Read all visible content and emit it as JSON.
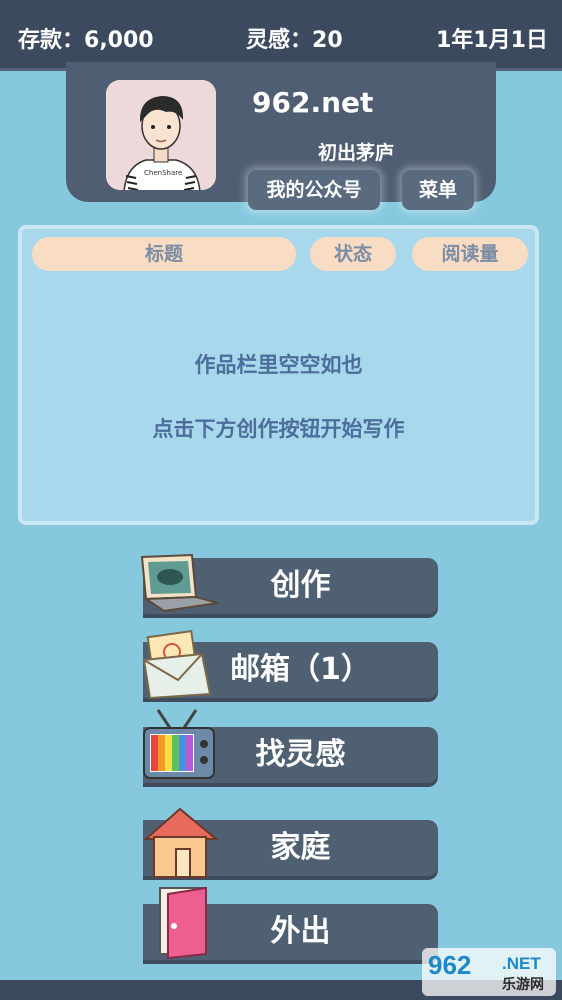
{
  "status": {
    "money_label": "存款：",
    "money_value": "6,000",
    "inspiration_label": "灵感：",
    "inspiration_value": "20",
    "date": "1年1月1日"
  },
  "profile": {
    "avatar_shirt_text": "ChenShare",
    "name": "962.net",
    "title": "初出茅庐",
    "wechat_button": "我的公众号",
    "menu_button": "菜单"
  },
  "works": {
    "columns": [
      "标题",
      "状态",
      "阅读量"
    ],
    "empty_line1": "作品栏里空空如也",
    "empty_line2": "点击下方创作按钮开始写作"
  },
  "actions": [
    {
      "label": "创作",
      "icon": "laptop-icon"
    },
    {
      "label": "邮箱（1）",
      "icon": "mail-envelope-icon"
    },
    {
      "label": "找灵感",
      "icon": "tv-icon"
    },
    {
      "label": "家庭",
      "icon": "house-icon"
    },
    {
      "label": "外出",
      "icon": "door-icon"
    }
  ],
  "watermark": {
    "brand": "962",
    "suffix": ".NET",
    "text": "乐游网"
  },
  "colors": {
    "background": "#86c9df",
    "topbar": "#3b4a5e",
    "button": "#506073",
    "column_header": "#f9dcc4",
    "empty_text": "#4d6d9a"
  }
}
